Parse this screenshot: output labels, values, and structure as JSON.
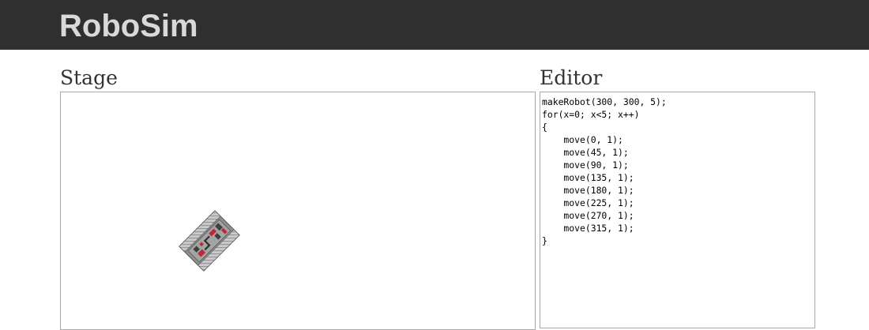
{
  "header": {
    "app_title": "RoboSim"
  },
  "stage": {
    "title": "Stage"
  },
  "editor": {
    "title": "Editor",
    "code": "makeRobot(300, 300, 5);\nfor(x=0; x<5; x++)\n{\n    move(0, 1);\n    move(45, 1);\n    move(90, 1);\n    move(135, 1);\n    move(180, 1);\n    move(225, 1);\n    move(270, 1);\n    move(315, 1);\n}"
  },
  "robot": {
    "icon": "robot-icon",
    "colors": {
      "body": "#8a8a8a",
      "tread": "#bdbdbd",
      "accent": "#c0283a",
      "dark": "#444444"
    }
  }
}
